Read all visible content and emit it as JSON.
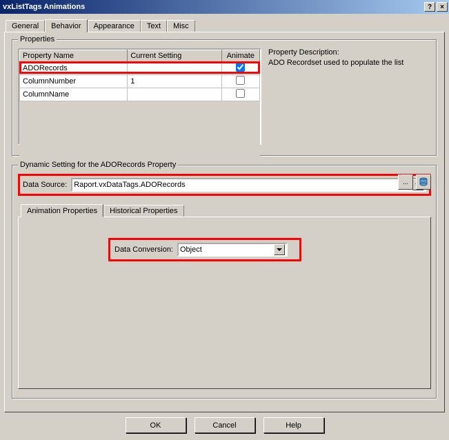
{
  "window": {
    "title": "vxListTags Animations",
    "help_btn": "?",
    "close_btn": "×"
  },
  "main_tabs": [
    "General",
    "Behavior",
    "Appearance",
    "Text",
    "Misc"
  ],
  "active_tab": "Behavior",
  "properties_group": {
    "legend": "Properties",
    "columns": [
      "Property Name",
      "Current Setting",
      "Animate"
    ],
    "rows": [
      {
        "name": "ADORecords",
        "setting": "",
        "animate": true
      },
      {
        "name": "ColumnNumber",
        "setting": "1",
        "animate": false
      },
      {
        "name": "ColumnName",
        "setting": "",
        "animate": false
      }
    ],
    "description_label": "Property Description:",
    "description_text": "ADO Recordset used to populate the list"
  },
  "dynamic_group": {
    "legend": "Dynamic Setting for the ADORecords Property",
    "data_source_label": "Data Source:",
    "data_source_value": "Raport.vxDataTags.ADORecords",
    "browse_btn": "...",
    "inner_tabs": [
      "Animation Properties",
      "Historical Properties"
    ],
    "active_inner_tab": "Animation Properties",
    "conversion_label": "Data Conversion:",
    "conversion_value": "Object"
  },
  "buttons": {
    "ok": "OK",
    "cancel": "Cancel",
    "help": "Help"
  }
}
